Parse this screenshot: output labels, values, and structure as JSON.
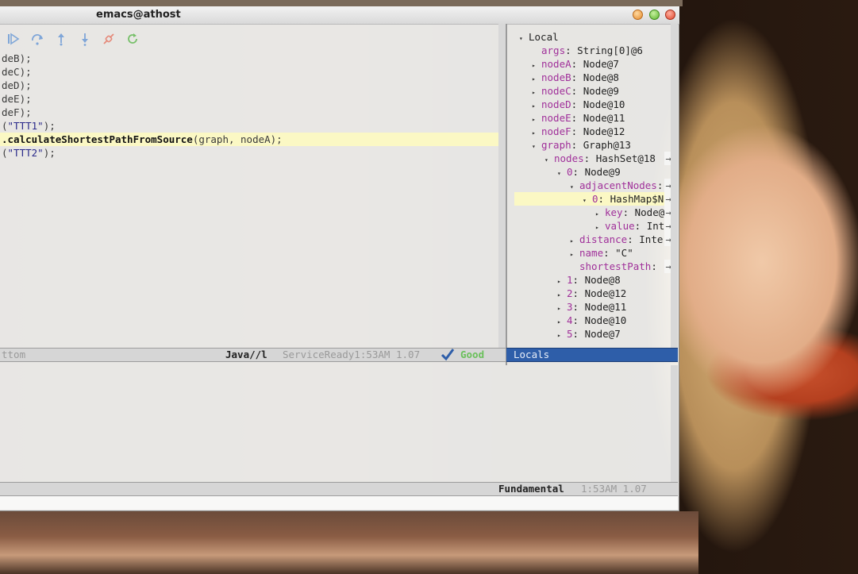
{
  "window": {
    "title": "emacs@athost"
  },
  "toolbar": {
    "icons": [
      "continue-icon",
      "step-over-icon",
      "step-out-icon",
      "step-into-icon",
      "disconnect-icon",
      "restart-icon"
    ]
  },
  "code": {
    "lines": [
      {
        "text": "deB);"
      },
      {
        "text": "deC);"
      },
      {
        "text": "deD);"
      },
      {
        "text": "deE);"
      },
      {
        "text": "deF);"
      },
      {
        "pre": "(",
        "str": "\"TTT1\"",
        "post": ");"
      },
      {
        "fn": ".calculateShortestPathFromSource",
        "post": "(graph, nodeA);",
        "highlight": true
      },
      {
        "pre": "(",
        "str": "\"TTT2\"",
        "post": ");"
      }
    ]
  },
  "locals": {
    "root": "Local",
    "rows": [
      {
        "indent": 0,
        "tri": "open",
        "plain": "Local"
      },
      {
        "indent": 1,
        "tri": "none",
        "key": "args",
        "val": ": String[0]@6"
      },
      {
        "indent": 1,
        "tri": "closed",
        "key": "nodeA",
        "val": ": Node@7"
      },
      {
        "indent": 1,
        "tri": "closed",
        "key": "nodeB",
        "val": ": Node@8"
      },
      {
        "indent": 1,
        "tri": "closed",
        "key": "nodeC",
        "val": ": Node@9"
      },
      {
        "indent": 1,
        "tri": "closed",
        "key": "nodeD",
        "val": ": Node@10"
      },
      {
        "indent": 1,
        "tri": "closed",
        "key": "nodeE",
        "val": ": Node@11"
      },
      {
        "indent": 1,
        "tri": "closed",
        "key": "nodeF",
        "val": ": Node@12"
      },
      {
        "indent": 1,
        "tri": "open",
        "key": "graph",
        "val": ": Graph@13"
      },
      {
        "indent": 2,
        "tri": "open",
        "key": "nodes",
        "val": ": HashSet@18",
        "more": true
      },
      {
        "indent": 3,
        "tri": "open",
        "key": "0",
        "val": ": Node@9"
      },
      {
        "indent": 4,
        "tri": "open",
        "key": "adjacentNodes",
        "val": ":",
        "more": true
      },
      {
        "indent": 5,
        "tri": "open",
        "key": "0",
        "val": ": HashMap$N",
        "selected": true,
        "more": true
      },
      {
        "indent": 6,
        "tri": "closed",
        "key": "key",
        "val": ": Node@",
        "more": true
      },
      {
        "indent": 6,
        "tri": "closed",
        "key": "value",
        "val": ": Int",
        "more": true
      },
      {
        "indent": 4,
        "tri": "closed",
        "key": "distance",
        "val": ": Inte",
        "more": true
      },
      {
        "indent": 4,
        "tri": "closed",
        "key": "name",
        "val": ": \"C\""
      },
      {
        "indent": 4,
        "tri": "none",
        "key": "shortestPath",
        "val": ":",
        "more": true
      },
      {
        "indent": 3,
        "tri": "closed",
        "key": "1",
        "val": ": Node@8"
      },
      {
        "indent": 3,
        "tri": "closed",
        "key": "2",
        "val": ": Node@12"
      },
      {
        "indent": 3,
        "tri": "closed",
        "key": "3",
        "val": ": Node@11"
      },
      {
        "indent": 3,
        "tri": "closed",
        "key": "4",
        "val": ": Node@10"
      },
      {
        "indent": 3,
        "tri": "closed",
        "key": "5",
        "val": ": Node@7"
      }
    ]
  },
  "modeline_left": {
    "pos": "ttom",
    "mode": "Java//l",
    "status": "ServiceReady1:53AM 1.07",
    "check": "Good"
  },
  "modeline_right": {
    "buffer": "Locals"
  },
  "modeline_bottom": {
    "mode": "Fundamental",
    "time": "1:53AM 1.07"
  },
  "colors": {
    "accent": "#2e5ea9",
    "highlight": "#fbf8c4",
    "key": "#a0309a"
  }
}
